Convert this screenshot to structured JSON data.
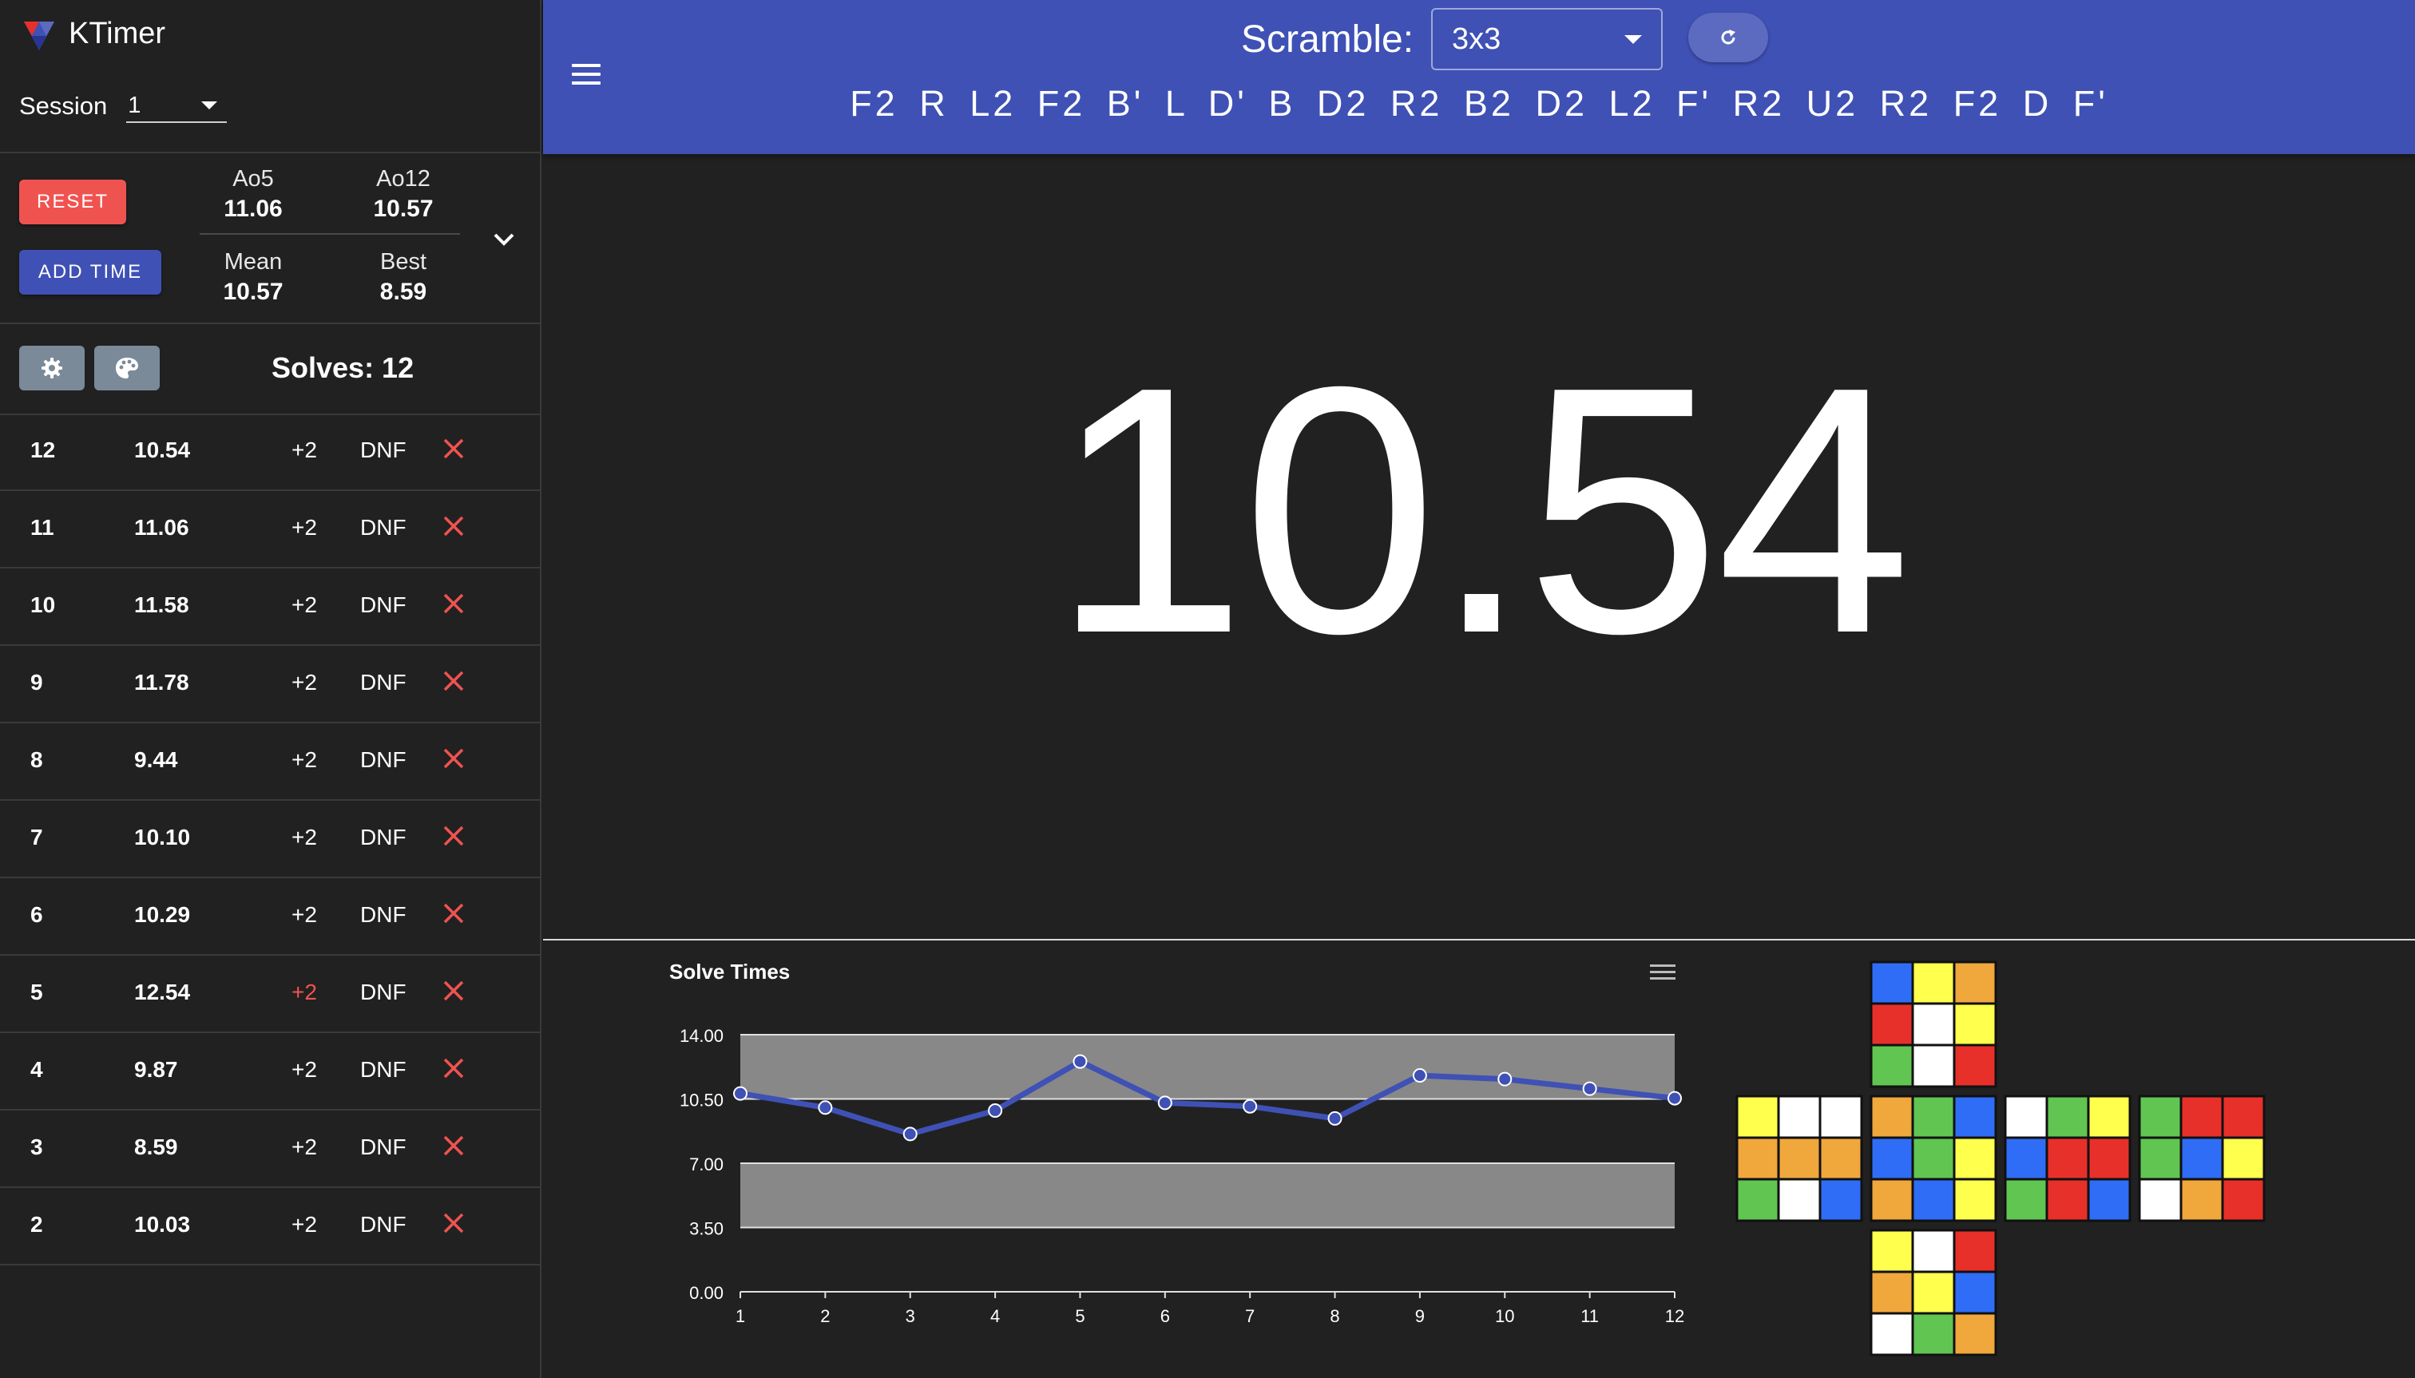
{
  "app": {
    "name": "KTimer",
    "brand_color": "#3f51b5"
  },
  "session": {
    "label": "Session",
    "value": "1"
  },
  "buttons": {
    "reset": "RESET",
    "add_time": "ADD TIME"
  },
  "stats": {
    "ao5": {
      "label": "Ao5",
      "value": "11.06"
    },
    "ao12": {
      "label": "Ao12",
      "value": "10.57"
    },
    "mean": {
      "label": "Mean",
      "value": "10.57"
    },
    "best": {
      "label": "Best",
      "value": "8.59"
    }
  },
  "solves_label": "Solves: 12",
  "solves": [
    {
      "num": "12",
      "time": "10.54",
      "plus": "+2",
      "dnf": "DNF",
      "plus_active": false
    },
    {
      "num": "11",
      "time": "11.06",
      "plus": "+2",
      "dnf": "DNF",
      "plus_active": false
    },
    {
      "num": "10",
      "time": "11.58",
      "plus": "+2",
      "dnf": "DNF",
      "plus_active": false
    },
    {
      "num": "9",
      "time": "11.78",
      "plus": "+2",
      "dnf": "DNF",
      "plus_active": false
    },
    {
      "num": "8",
      "time": "9.44",
      "plus": "+2",
      "dnf": "DNF",
      "plus_active": false
    },
    {
      "num": "7",
      "time": "10.10",
      "plus": "+2",
      "dnf": "DNF",
      "plus_active": false
    },
    {
      "num": "6",
      "time": "10.29",
      "plus": "+2",
      "dnf": "DNF",
      "plus_active": false
    },
    {
      "num": "5",
      "time": "12.54",
      "plus": "+2",
      "dnf": "DNF",
      "plus_active": true
    },
    {
      "num": "4",
      "time": "9.87",
      "plus": "+2",
      "dnf": "DNF",
      "plus_active": false
    },
    {
      "num": "3",
      "time": "8.59",
      "plus": "+2",
      "dnf": "DNF",
      "plus_active": false
    },
    {
      "num": "2",
      "time": "10.03",
      "plus": "+2",
      "dnf": "DNF",
      "plus_active": false
    }
  ],
  "scramble": {
    "label": "Scramble:",
    "puzzle": "3x3",
    "moves": "F2 R L2 F2 B' L D' B D2 R2 B2 D2 L2 F' R2 U2 R2 F2 D F'"
  },
  "timer": {
    "display": "10.54"
  },
  "icons": {
    "menu": "menu-icon",
    "refresh": "refresh-icon",
    "settings": "gear-icon",
    "palette": "palette-icon",
    "delete": "close-icon",
    "chart_menu": "hamburger-icon"
  },
  "colors": {
    "accent": "#3f51b5",
    "danger": "#ef5350",
    "background": "#212121",
    "plot_band": "#888888"
  },
  "chart_data": {
    "type": "line",
    "title": "Solve Times",
    "x": [
      1,
      2,
      3,
      4,
      5,
      6,
      7,
      8,
      9,
      10,
      11,
      12
    ],
    "x_ticks": [
      "1",
      "2",
      "3",
      "4",
      "5",
      "6",
      "7",
      "8",
      "9",
      "10",
      "11",
      "12"
    ],
    "y_ticks": [
      "0.00",
      "3.50",
      "7.00",
      "10.50",
      "14.00"
    ],
    "ylim": [
      0,
      14
    ],
    "series": [
      {
        "values": [
          10.03,
          8.59,
          9.87,
          12.54,
          10.29,
          10.1,
          9.44,
          11.78,
          11.58,
          11.06,
          10.54
        ],
        "offset": 1
      }
    ],
    "values_by_solve": [
      10.8,
      10.03,
      8.59,
      9.87,
      12.54,
      10.29,
      10.1,
      9.44,
      11.78,
      11.58,
      11.06,
      10.54
    ],
    "line_color": "#3f51b5",
    "grid": true
  },
  "cube_net": {
    "U": [
      "B",
      "Y",
      "O",
      "R",
      "W",
      "Y",
      "G",
      "W",
      "R"
    ],
    "L": [
      "Y",
      "W",
      "W",
      "O",
      "O",
      "O",
      "G",
      "W",
      "B"
    ],
    "F": [
      "O",
      "G",
      "B",
      "B",
      "G",
      "Y",
      "O",
      "B",
      "Y"
    ],
    "R": [
      "W",
      "G",
      "Y",
      "B",
      "R",
      "R",
      "G",
      "R",
      "B"
    ],
    "B": [
      "G",
      "R",
      "R",
      "G",
      "B",
      "Y",
      "W",
      "O",
      "R"
    ],
    "D": [
      "Y",
      "W",
      "R",
      "O",
      "Y",
      "B",
      "W",
      "G",
      "O"
    ],
    "palette": {
      "W": "#ffffff",
      "Y": "#ffff4d",
      "R": "#e8302a",
      "O": "#f0a73c",
      "B": "#2f6df6",
      "G": "#61c552"
    }
  }
}
